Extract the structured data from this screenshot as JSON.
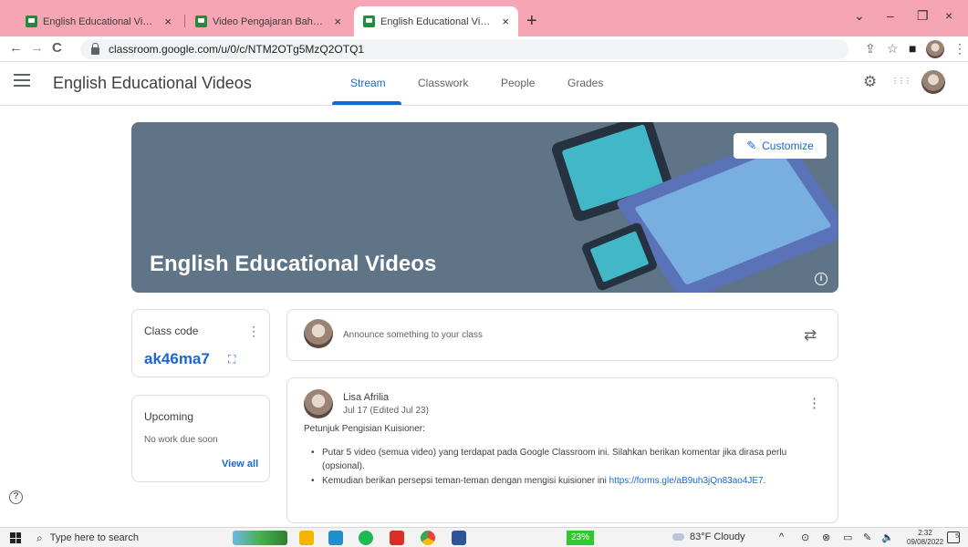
{
  "browser": {
    "tabs": [
      {
        "title": "English Educational Video (Vide",
        "active": false
      },
      {
        "title": "Video Pengajaran Bahasa Inggris",
        "active": false
      },
      {
        "title": "English Educational Videos",
        "active": true
      }
    ],
    "tab_close": "×",
    "new_tab": "+",
    "url": "classroom.google.com/u/0/c/NTM2OTg5MzQ2OTQ1",
    "window_controls": {
      "chevron": "⌄",
      "minimize": "–",
      "restore": "❐",
      "close": "×"
    },
    "nav_icons": {
      "back": "←",
      "forward": "→",
      "reload": "C"
    },
    "toolbar_icons": {
      "share": "⇪",
      "bookmark": "☆",
      "sidepanel": "■",
      "menu": "⋮"
    }
  },
  "classroom": {
    "class_name": "English Educational Videos",
    "tabs": [
      "Stream",
      "Classwork",
      "People",
      "Grades"
    ],
    "active_tab": "Stream",
    "header_icons": {
      "settings": "⚙",
      "apps": "⋮⋮⋮"
    },
    "banner": {
      "title": "English Educational Videos",
      "customize_label": "Customize",
      "pencil": "✎",
      "info": "i",
      "colors": {
        "background": "#5f7486"
      }
    },
    "class_code": {
      "label": "Class code",
      "value": "ak46ma7",
      "kebab": "⋮",
      "expand": "⛶"
    },
    "upcoming": {
      "title": "Upcoming",
      "empty_text": "No work due soon",
      "view_all": "View all"
    },
    "announce": {
      "placeholder": "Announce something to your class",
      "repost": "⇄"
    },
    "post": {
      "author": "Lisa Afrilia",
      "date": "Jul 17 (Edited Jul 23)",
      "kebab": "⋮",
      "intro": "Petunjuk Pengisian Kuisioner:",
      "item1": "Putar 5 video (semua video) yang terdapat pada Google Classroom ini. Silahkan berikan komentar jika dirasa perlu (opsional).",
      "item2_text": "Kemudian berikan persepsi teman-teman dengan mengisi kuisioner ini ",
      "item2_link": "https://forms.gle/aB9uh3jQn83ao4JE7",
      "item2_end": "."
    },
    "help": "?",
    "accent_color": "#1967d2"
  },
  "taskbar": {
    "search_placeholder": "Type here to search",
    "search_icon": "⌕",
    "battery": "23%",
    "weather": "83°F  Cloudy",
    "tray_chevron": "^",
    "time": "2:32",
    "date": "09/08/2022",
    "notifications": "5"
  }
}
